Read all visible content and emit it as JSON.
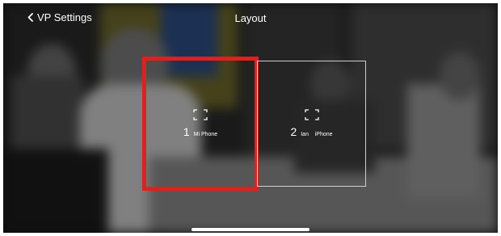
{
  "nav": {
    "back_label": "VP Settings",
    "title": "Layout"
  },
  "tiles": [
    {
      "number": "1",
      "device": "Mi Phone",
      "selected": true,
      "icon": "expand-icon"
    },
    {
      "number": "2",
      "device": "Ian    iPhone",
      "selected": false,
      "icon": "expand-icon"
    }
  ],
  "colors": {
    "selection_border": "#e0201e",
    "text": "#ffffff"
  }
}
